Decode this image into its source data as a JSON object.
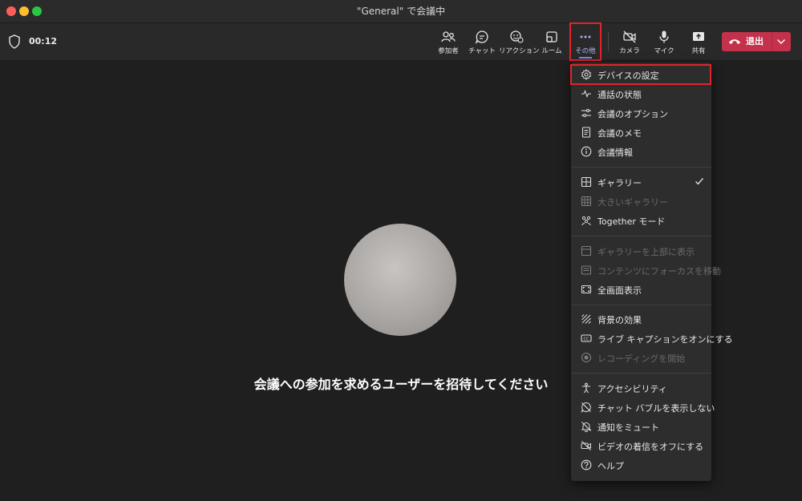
{
  "window": {
    "title": "\"General\" で会議中"
  },
  "call": {
    "timer": "00:12"
  },
  "toolbar": {
    "participants": "参加者",
    "chat": "チャット",
    "reactions": "リアクション",
    "rooms": "ルーム",
    "more": "その他",
    "camera": "カメラ",
    "mic": "マイク",
    "share": "共有",
    "leave": "退出"
  },
  "main": {
    "invite_text": "会議への参加を求めるユーザーを招待してください"
  },
  "menu": {
    "device_settings": "デバイスの設定",
    "call_health": "通話の状態",
    "meeting_options": "会議のオプション",
    "meeting_notes": "会議のメモ",
    "meeting_info": "会議情報",
    "gallery": "ギャラリー",
    "large_gallery": "大きいギャラリー",
    "together_mode": "Together モード",
    "gallery_top": "ギャラリーを上部に表示",
    "focus_content": "コンテンツにフォーカスを移動",
    "fullscreen": "全画面表示",
    "background_effects": "背景の効果",
    "live_captions": "ライブ キャプションをオンにする",
    "start_recording": "レコーディングを開始",
    "accessibility": "アクセシビリティ",
    "hide_chat_bubbles": "チャット バブルを表示しない",
    "mute_notifications": "通知をミュート",
    "video_off_incoming": "ビデオの着信をオフにする",
    "help": "ヘルプ"
  },
  "colors": {
    "accent": "#7f85f5",
    "leave": "#c4314b",
    "highlight": "#e0242c"
  }
}
